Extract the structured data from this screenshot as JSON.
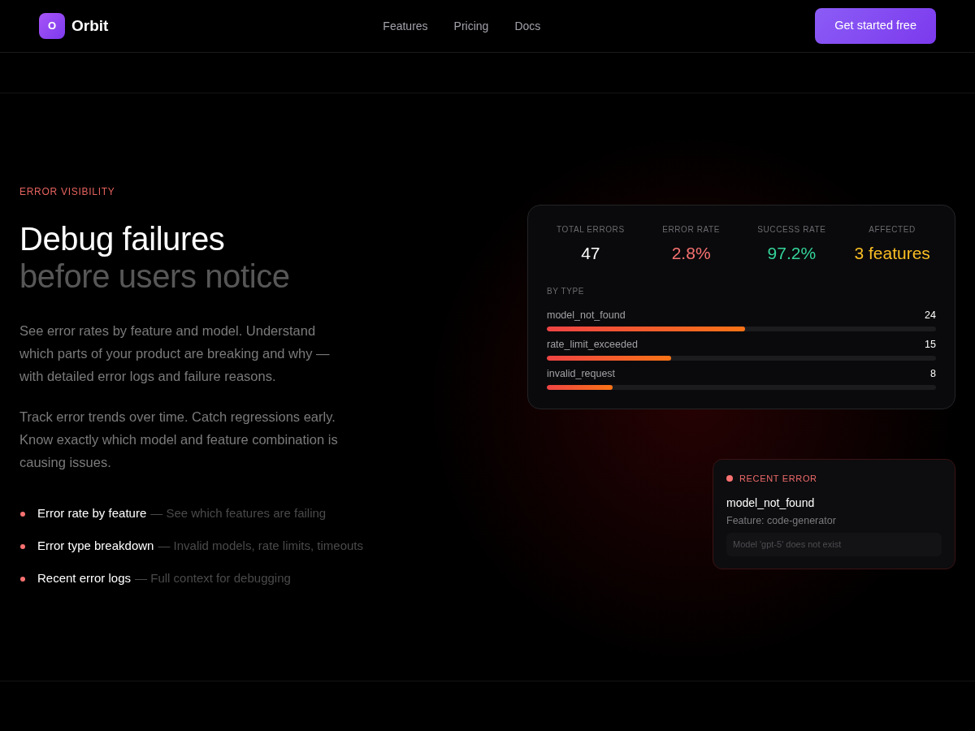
{
  "nav": {
    "brand": {
      "logo_letter": "O",
      "name": "Orbit"
    },
    "links": [
      "Features",
      "Pricing",
      "Docs"
    ],
    "cta": "Get started free"
  },
  "hero": {
    "eyebrow": "ERROR VISIBILITY",
    "title": "Debug failures",
    "subtitle": "before users notice",
    "paragraphs": [
      "See error rates by feature and model. Understand which parts of your product are breaking and why — with detailed error logs and failure reasons.",
      "Track error trends over time. Catch regressions early. Know exactly which model and feature combination is causing issues."
    ],
    "features": [
      {
        "title": "Error rate by feature",
        "description": "— See which features are failing"
      },
      {
        "title": "Error type breakdown",
        "description": "— Invalid models, rate limits, timeouts"
      },
      {
        "title": "Recent error logs",
        "description": "— Full context for debugging"
      }
    ]
  },
  "stats_card": {
    "stats": [
      {
        "label": "TOTAL ERRORS",
        "value": "47",
        "color": "#ffffff"
      },
      {
        "label": "ERROR RATE",
        "value": "2.8%",
        "color": "#f87171"
      },
      {
        "label": "SUCCESS RATE",
        "value": "97.2%",
        "color": "#34d399"
      },
      {
        "label": "AFFECTED",
        "value": "3 features",
        "color": "#fbbf24"
      }
    ],
    "section_label": "BY TYPE",
    "error_types": [
      {
        "name": "model_not_found",
        "count": "24",
        "level": 0.51
      },
      {
        "name": "rate_limit_exceeded",
        "count": "15",
        "level": 0.32
      },
      {
        "name": "invalid_request",
        "count": "8",
        "level": 0.17
      }
    ]
  },
  "recent_error": {
    "label": "RECENT ERROR",
    "error": "model_not_found",
    "feature": "Feature: code-generator",
    "message": "Model 'gpt-5' does not exist"
  }
}
